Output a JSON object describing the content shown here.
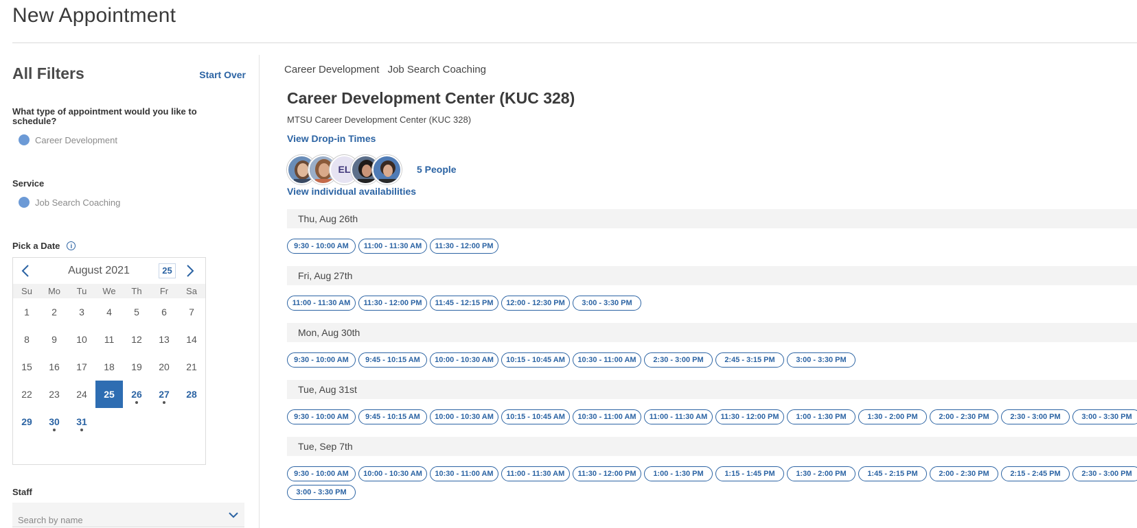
{
  "page": {
    "title": "New Appointment"
  },
  "sidebar": {
    "title": "All Filters",
    "start_over": "Start Over",
    "appointment_question": "What type of appointment would you like to schedule?",
    "appointment_type": "Career Development",
    "service_label": "Service",
    "service_value": "Job Search Coaching",
    "date_label": "Pick a Date",
    "staff_label": "Staff",
    "staff_placeholder": "Search by name"
  },
  "calendar": {
    "month": "August 2021",
    "today": "25",
    "dow": [
      "Su",
      "Mo",
      "Tu",
      "We",
      "Th",
      "Fr",
      "Sa"
    ],
    "days": [
      {
        "d": "1"
      },
      {
        "d": "2"
      },
      {
        "d": "3"
      },
      {
        "d": "4"
      },
      {
        "d": "5"
      },
      {
        "d": "6"
      },
      {
        "d": "7"
      },
      {
        "d": "8"
      },
      {
        "d": "9"
      },
      {
        "d": "10"
      },
      {
        "d": "11"
      },
      {
        "d": "12"
      },
      {
        "d": "13"
      },
      {
        "d": "14"
      },
      {
        "d": "15"
      },
      {
        "d": "16"
      },
      {
        "d": "17"
      },
      {
        "d": "18"
      },
      {
        "d": "19"
      },
      {
        "d": "20"
      },
      {
        "d": "21"
      },
      {
        "d": "22"
      },
      {
        "d": "23"
      },
      {
        "d": "24"
      },
      {
        "d": "25",
        "selected": true
      },
      {
        "d": "26",
        "avail": true,
        "dot": true
      },
      {
        "d": "27",
        "avail": true,
        "dot": true
      },
      {
        "d": "28",
        "avail": true
      },
      {
        "d": "29",
        "avail": true
      },
      {
        "d": "30",
        "avail": true,
        "dot": true
      },
      {
        "d": "31",
        "avail": true,
        "dot": true
      }
    ]
  },
  "main": {
    "breadcrumb": [
      "Career Development",
      "Job Search Coaching"
    ],
    "location_title": "Career Development Center (KUC 328)",
    "location_sub": "MTSU Career Development Center (KUC 328)",
    "dropin_link": "View Drop-in Times",
    "people_link": "5 People",
    "avatar_initials": "EL",
    "individual_link": "View individual availabilities"
  },
  "schedule": [
    {
      "day": "Thu, Aug 26th",
      "slots": [
        "9:30 - 10:00 AM",
        "11:00 - 11:30 AM",
        "11:30 - 12:00 PM"
      ]
    },
    {
      "day": "Fri, Aug 27th",
      "slots": [
        "11:00 - 11:30 AM",
        "11:30 - 12:00 PM",
        "11:45 - 12:15 PM",
        "12:00 - 12:30 PM",
        "3:00 - 3:30 PM"
      ]
    },
    {
      "day": "Mon, Aug 30th",
      "slots": [
        "9:30 - 10:00 AM",
        "9:45 - 10:15 AM",
        "10:00 - 10:30 AM",
        "10:15 - 10:45 AM",
        "10:30 - 11:00 AM",
        "2:30 - 3:00 PM",
        "2:45 - 3:15 PM",
        "3:00 - 3:30 PM"
      ]
    },
    {
      "day": "Tue, Aug 31st",
      "slots": [
        "9:30 - 10:00 AM",
        "9:45 - 10:15 AM",
        "10:00 - 10:30 AM",
        "10:15 - 10:45 AM",
        "10:30 - 11:00 AM",
        "11:00 - 11:30 AM",
        "11:30 - 12:00 PM",
        "1:00 - 1:30 PM",
        "1:30 - 2:00 PM",
        "2:00 - 2:30 PM",
        "2:30 - 3:00 PM",
        "3:00 - 3:30 PM"
      ]
    },
    {
      "day": "Tue, Sep 7th",
      "slots": [
        "9:30 - 10:00 AM",
        "10:00 - 10:30 AM",
        "10:30 - 11:00 AM",
        "11:00 - 11:30 AM",
        "11:30 - 12:00 PM",
        "1:00 - 1:30 PM",
        "1:15 - 1:45 PM",
        "1:30 - 2:00 PM",
        "1:45 - 2:15 PM",
        "2:00 - 2:30 PM",
        "2:15 - 2:45 PM",
        "2:30 - 3:00 PM",
        "3:00 - 3:30 PM"
      ]
    }
  ],
  "colors": {
    "accent": "#2b63a3",
    "selected_day": "#2e6db2",
    "radio": "#6c9ad6",
    "day_header_bg": "#f3f3f3"
  },
  "icons": {
    "prev": "chevron-left-icon",
    "next": "chevron-right-icon",
    "info": "info-icon",
    "dropdown": "chevron-down-icon"
  }
}
